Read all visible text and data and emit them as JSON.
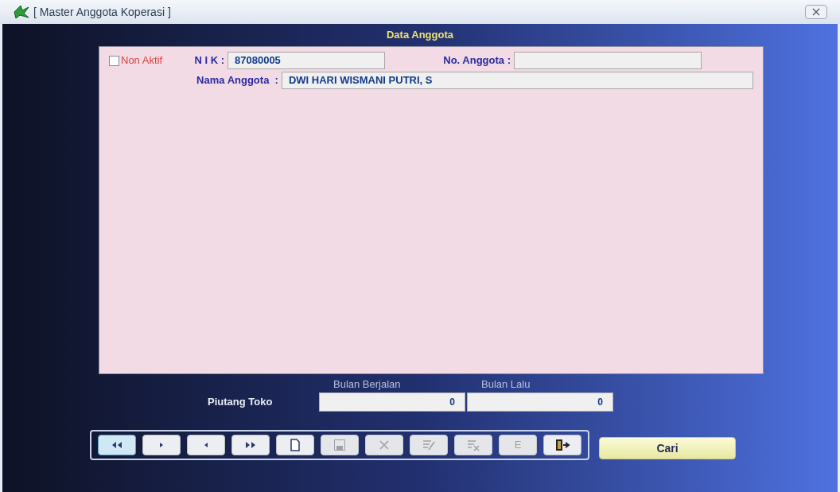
{
  "window": {
    "title": "[ Master Anggota Koperasi ]"
  },
  "section_title": "Data Anggota",
  "form": {
    "non_aktif": {
      "label": "Non Aktif",
      "checked": false
    },
    "nik": {
      "label": "N I K :",
      "value": "87080005"
    },
    "no_anggota": {
      "label": "No. Anggota :"
    },
    "nama": {
      "label": "Nama Anggota  :",
      "value": "DWI HARI WISMANI PUTRI, S"
    }
  },
  "piutang": {
    "label": "Piutang Toko",
    "columns": [
      "Bulan Berjalan",
      "Bulan Lalu"
    ],
    "values": [
      "0",
      "0"
    ]
  },
  "toolbar": [
    {
      "kind": "first",
      "selected": true,
      "disabled": false
    },
    {
      "kind": "next",
      "selected": false,
      "disabled": false
    },
    {
      "kind": "prev",
      "selected": false,
      "disabled": false
    },
    {
      "kind": "last",
      "selected": false,
      "disabled": false
    },
    {
      "kind": "new",
      "selected": false,
      "disabled": false
    },
    {
      "kind": "save",
      "selected": false,
      "disabled": true
    },
    {
      "kind": "delete",
      "selected": false,
      "disabled": true
    },
    {
      "kind": "edit",
      "selected": false,
      "disabled": true
    },
    {
      "kind": "cancel",
      "selected": false,
      "disabled": true
    },
    {
      "kind": "text",
      "label": "E",
      "selected": false,
      "disabled": true
    },
    {
      "kind": "exit",
      "selected": false,
      "disabled": false
    }
  ],
  "search_button": "Cari"
}
